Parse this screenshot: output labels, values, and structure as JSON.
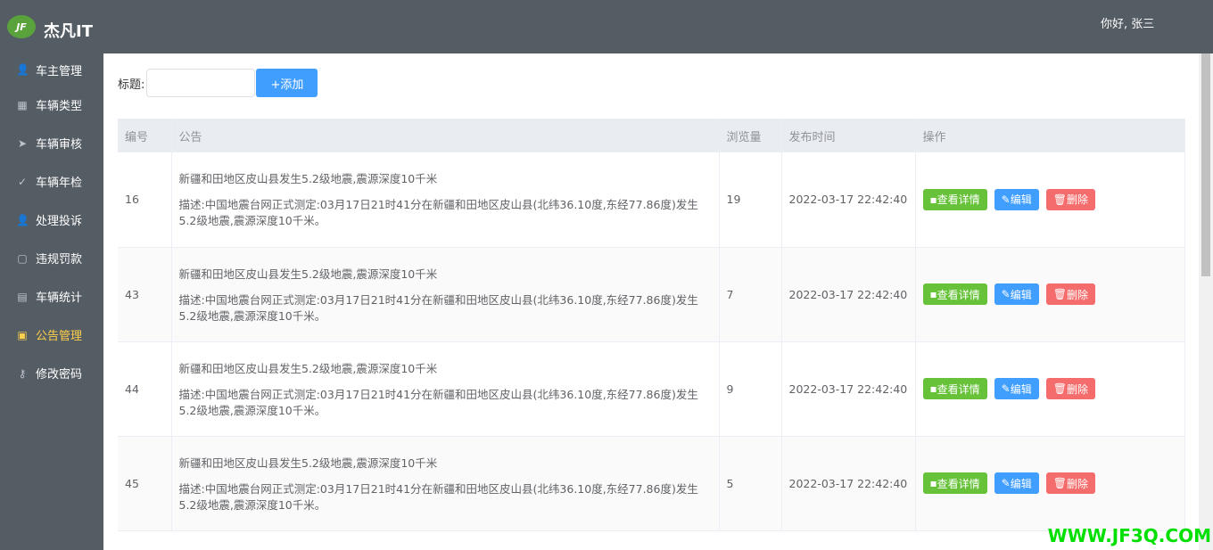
{
  "header": {
    "logo_mark": "JF",
    "logo_text": "杰凡IT",
    "greeting": "你好,  张三"
  },
  "sidebar": {
    "items": [
      {
        "label": "车主管理",
        "icon": "user-icon",
        "glyph": "👤"
      },
      {
        "label": "车辆类型",
        "icon": "grid-icon",
        "glyph": "▦"
      },
      {
        "label": "车辆审核",
        "icon": "send-icon",
        "glyph": "➤"
      },
      {
        "label": "车辆年检",
        "icon": "check-icon",
        "glyph": "✓"
      },
      {
        "label": "处理投诉",
        "icon": "user-icon",
        "glyph": "👤"
      },
      {
        "label": "违规罚款",
        "icon": "document-icon",
        "glyph": "▢"
      },
      {
        "label": "车辆统计",
        "icon": "document-icon",
        "glyph": "▤"
      },
      {
        "label": "公告管理",
        "icon": "notice-icon",
        "glyph": "▣"
      },
      {
        "label": "修改密码",
        "icon": "key-icon",
        "glyph": "⚷"
      }
    ],
    "active_index": 7
  },
  "toolbar": {
    "title_label": "标题:",
    "title_value": "",
    "add_label": "+添加"
  },
  "table": {
    "headers": [
      "编号",
      "公告",
      "浏览量",
      "发布时间",
      "操作"
    ],
    "rows": [
      {
        "id": "16",
        "title": "新疆和田地区皮山县发生5.2级地震,震源深度10千米",
        "desc": "描述:中国地震台网正式测定:03月17日21时41分在新疆和田地区皮山县(北纬36.10度,东经77.86度)发生5.2级地震,震源深度10千米。",
        "views": "19",
        "time": "2022-03-17 22:42:40"
      },
      {
        "id": "43",
        "title": "新疆和田地区皮山县发生5.2级地震,震源深度10千米",
        "desc": "描述:中国地震台网正式测定:03月17日21时41分在新疆和田地区皮山县(北纬36.10度,东经77.86度)发生5.2级地震,震源深度10千米。",
        "views": "7",
        "time": "2022-03-17 22:42:40"
      },
      {
        "id": "44",
        "title": "新疆和田地区皮山县发生5.2级地震,震源深度10千米",
        "desc": "描述:中国地震台网正式测定:03月17日21时41分在新疆和田地区皮山县(北纬36.10度,东经77.86度)发生5.2级地震,震源深度10千米。",
        "views": "9",
        "time": "2022-03-17 22:42:40"
      },
      {
        "id": "45",
        "title": "新疆和田地区皮山县发生5.2级地震,震源深度10千米",
        "desc": "描述:中国地震台网正式测定:03月17日21时41分在新疆和田地区皮山县(北纬36.10度,东经77.86度)发生5.2级地震,震源深度10千米。",
        "views": "5",
        "time": "2022-03-17 22:42:40"
      }
    ],
    "actions": {
      "view": "查看详情",
      "edit": "编辑",
      "delete": "删除"
    }
  },
  "watermark": "WWW.JF3Q.COM",
  "colors": {
    "sidebar_bg": "#545c64",
    "active_text": "#ffd04b",
    "primary": "#409eff",
    "success": "#67c23a",
    "danger": "#f56c6c"
  }
}
